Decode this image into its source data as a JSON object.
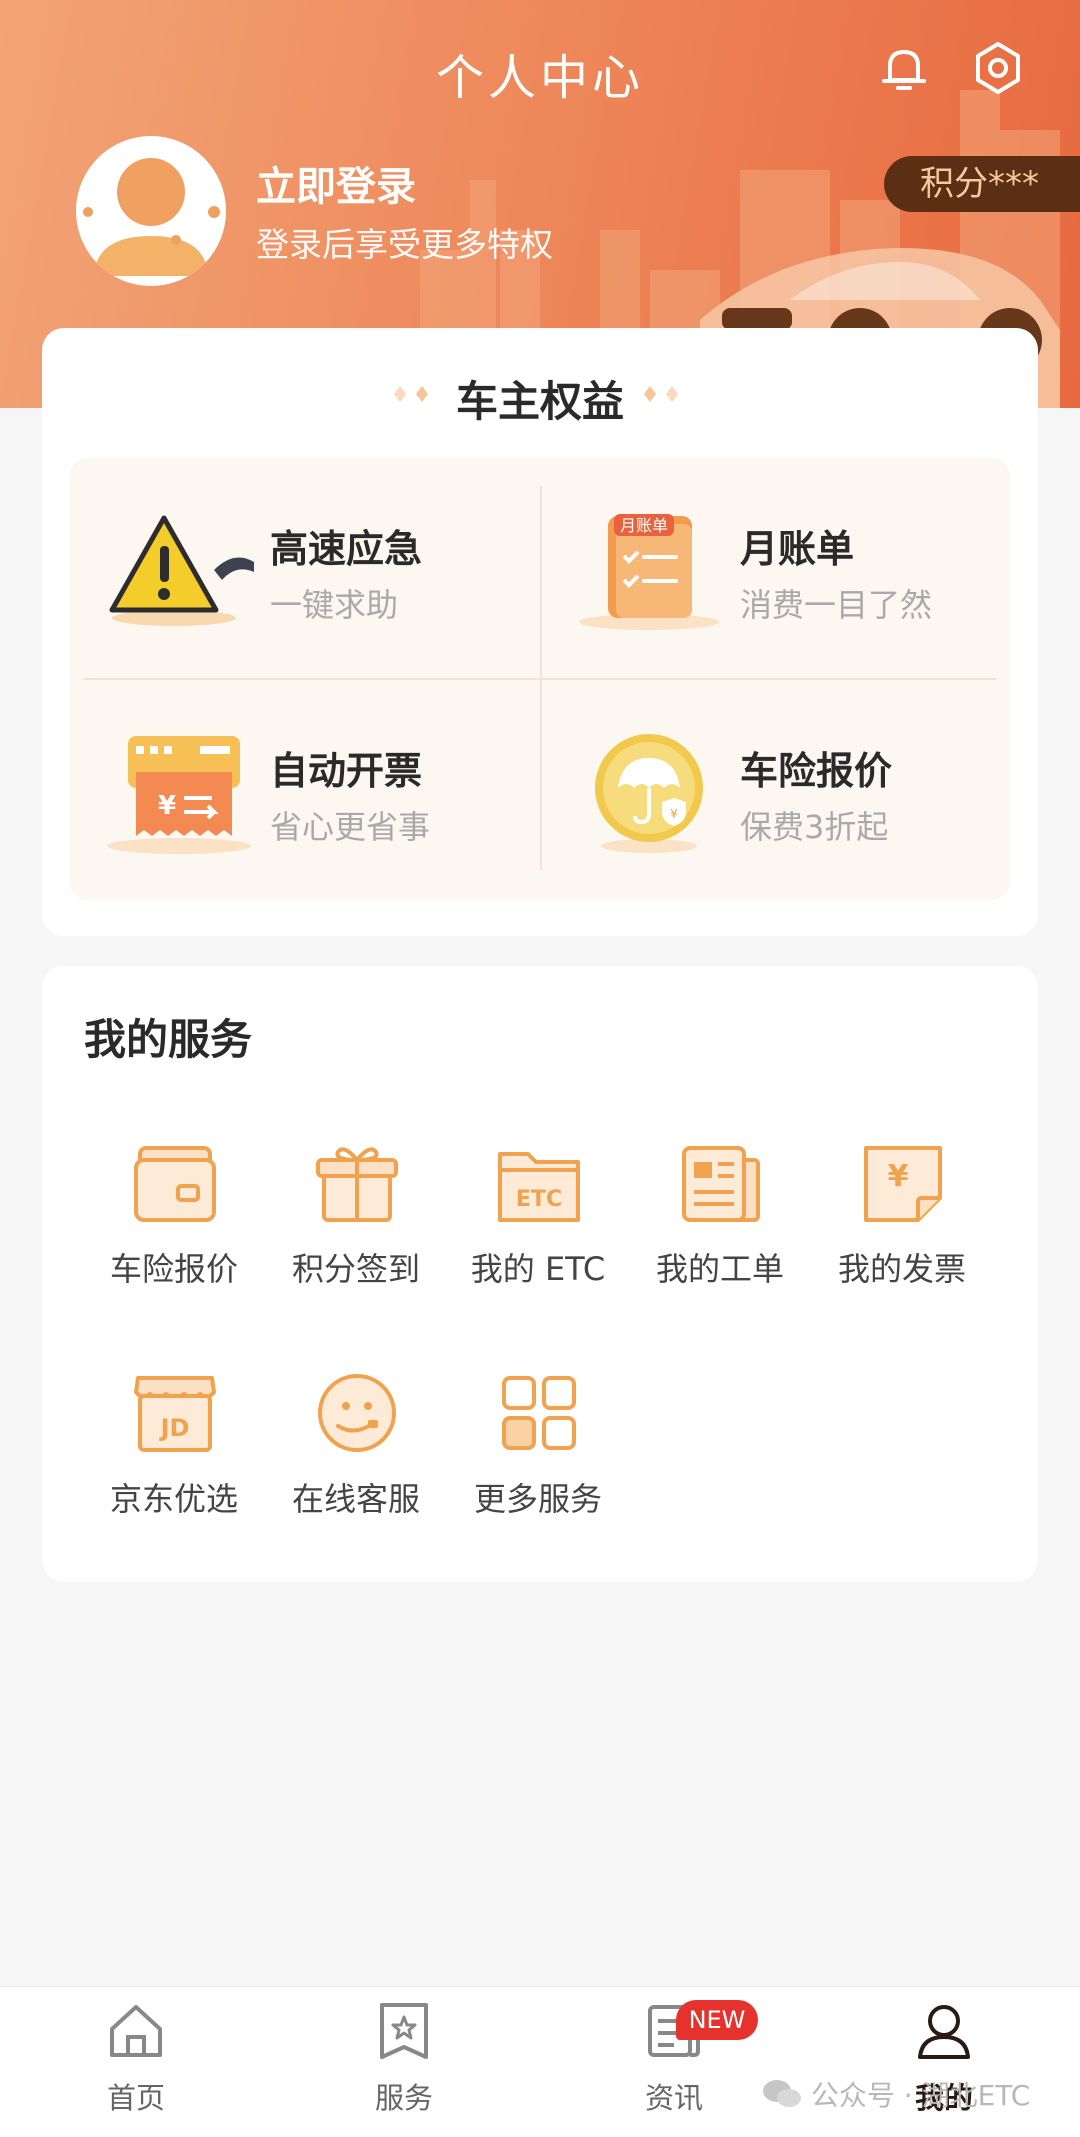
{
  "header": {
    "title": "个人中心",
    "bell_icon": "bell-icon",
    "settings_icon": "gear-icon"
  },
  "user": {
    "login_title": "立即登录",
    "login_sub": "登录后享受更多特权",
    "points": "积分***"
  },
  "benefits": {
    "title": "车主权益",
    "items": [
      {
        "title": "高速应急",
        "sub": "一键求助",
        "icon": "warning-triangle-icon"
      },
      {
        "title": "月账单",
        "sub": "消费一目了然",
        "icon": "monthly-bill-icon",
        "icon_text": "月账单"
      },
      {
        "title": "自动开票",
        "sub": "省心更省事",
        "icon": "invoice-ticket-icon"
      },
      {
        "title": "车险报价",
        "sub": "保费3折起",
        "icon": "umbrella-coin-icon"
      }
    ]
  },
  "services": {
    "title": "我的服务",
    "items": [
      {
        "label": "车险报价",
        "icon": "wallet-icon"
      },
      {
        "label": "积分签到",
        "icon": "gift-icon"
      },
      {
        "label": "我的 ETC",
        "icon": "etc-folder-icon"
      },
      {
        "label": "我的工单",
        "icon": "work-order-icon"
      },
      {
        "label": "我的发票",
        "icon": "invoice-icon"
      },
      {
        "label": "京东优选",
        "icon": "jd-store-icon"
      },
      {
        "label": "在线客服",
        "icon": "customer-service-icon"
      },
      {
        "label": "更多服务",
        "icon": "more-grid-icon"
      }
    ]
  },
  "tabbar": {
    "items": [
      {
        "label": "首页",
        "icon": "home-icon"
      },
      {
        "label": "服务",
        "icon": "service-star-icon"
      },
      {
        "label": "资讯",
        "icon": "news-icon"
      },
      {
        "label": "我的",
        "icon": "user-icon"
      }
    ],
    "badge": "NEW"
  },
  "watermark": "公众号 · 湖北ETC",
  "colors": {
    "accent": "#ee8a5c",
    "accent_dark": "#e8693f",
    "badge": "#e5322d",
    "points_bg": "#5a2f14",
    "icon_orange": "#f0a24e"
  }
}
